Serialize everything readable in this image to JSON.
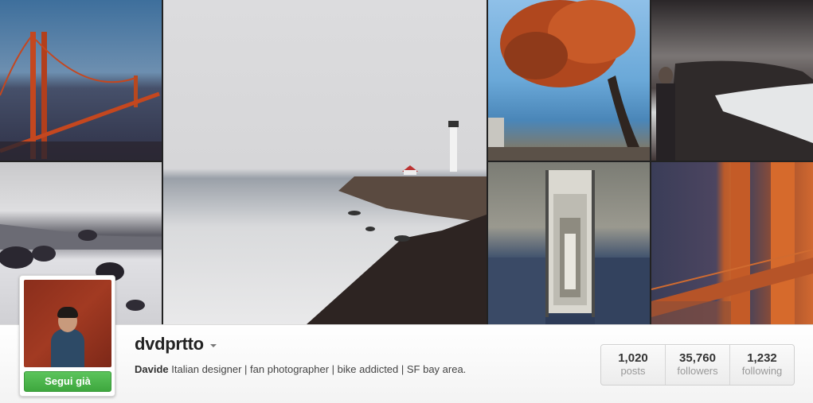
{
  "profile": {
    "username": "dvdprtto",
    "full_name": "Davide",
    "bio": "Italian designer | fan photographer | bike addicted | SF bay area.",
    "follow_button": "Segui già"
  },
  "stats": [
    {
      "value": "1,020",
      "label": "posts"
    },
    {
      "value": "35,760",
      "label": "followers"
    },
    {
      "value": "1,232",
      "label": "following"
    }
  ],
  "colors": {
    "follow_green": "#3ea73e",
    "avatar_red": "#a23a22"
  }
}
